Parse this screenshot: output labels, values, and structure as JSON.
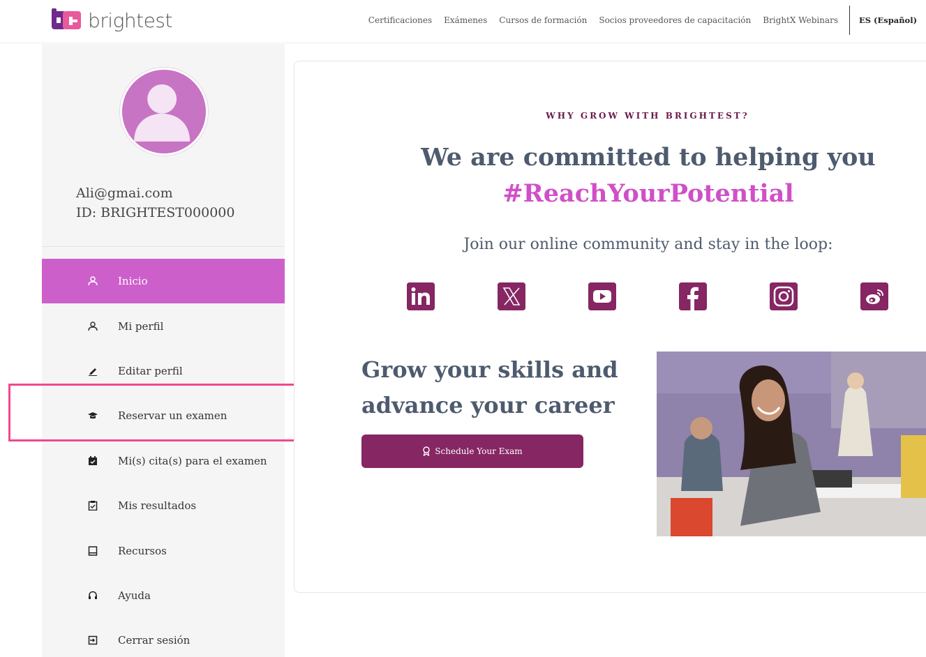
{
  "header": {
    "logo_text": "brightest",
    "nav": [
      "Certificaciones",
      "Exámenes",
      "Cursos de formación",
      "Socios proveedores de capacitación",
      "BrightX Webinars"
    ],
    "language": "ES (Español)"
  },
  "sidebar": {
    "email": "Ali@gmai.com",
    "user_id": "ID: BRIGHTEST000000",
    "items": [
      {
        "label": "Inicio",
        "icon": "user-icon",
        "active": true
      },
      {
        "label": "Mi perfil",
        "icon": "user-icon"
      },
      {
        "label": "Editar perfil",
        "icon": "pencil-icon"
      },
      {
        "label": "Reservar un examen",
        "icon": "graduation-cap-icon"
      },
      {
        "label": "Mi(s) cita(s) para el examen",
        "icon": "calendar-icon"
      },
      {
        "label": "Mis resultados",
        "icon": "clipboard-check-icon"
      },
      {
        "label": "Recursos",
        "icon": "book-icon"
      },
      {
        "label": "Ayuda",
        "icon": "headset-icon"
      },
      {
        "label": "Cerrar sesión",
        "icon": "logout-icon"
      }
    ]
  },
  "main": {
    "eyebrow": "WHY GROW WITH BRIGHTEST?",
    "headline": "We are committed to helping you",
    "hashtag": "#ReachYourPotential",
    "join_text": "Join our online community and stay in the loop:",
    "socials": [
      "linkedin-icon",
      "x-icon",
      "youtube-icon",
      "facebook-icon",
      "instagram-icon",
      "weibo-icon"
    ],
    "grow_line1": "Grow your skills and",
    "grow_line2": "advance your career",
    "cta_label": "Schedule Your Exam"
  },
  "colors": {
    "brand_primary": "#862663",
    "sidebar_active": "#cd5fcb",
    "hashtag": "#d04fc8",
    "highlight": "#f0488f"
  }
}
